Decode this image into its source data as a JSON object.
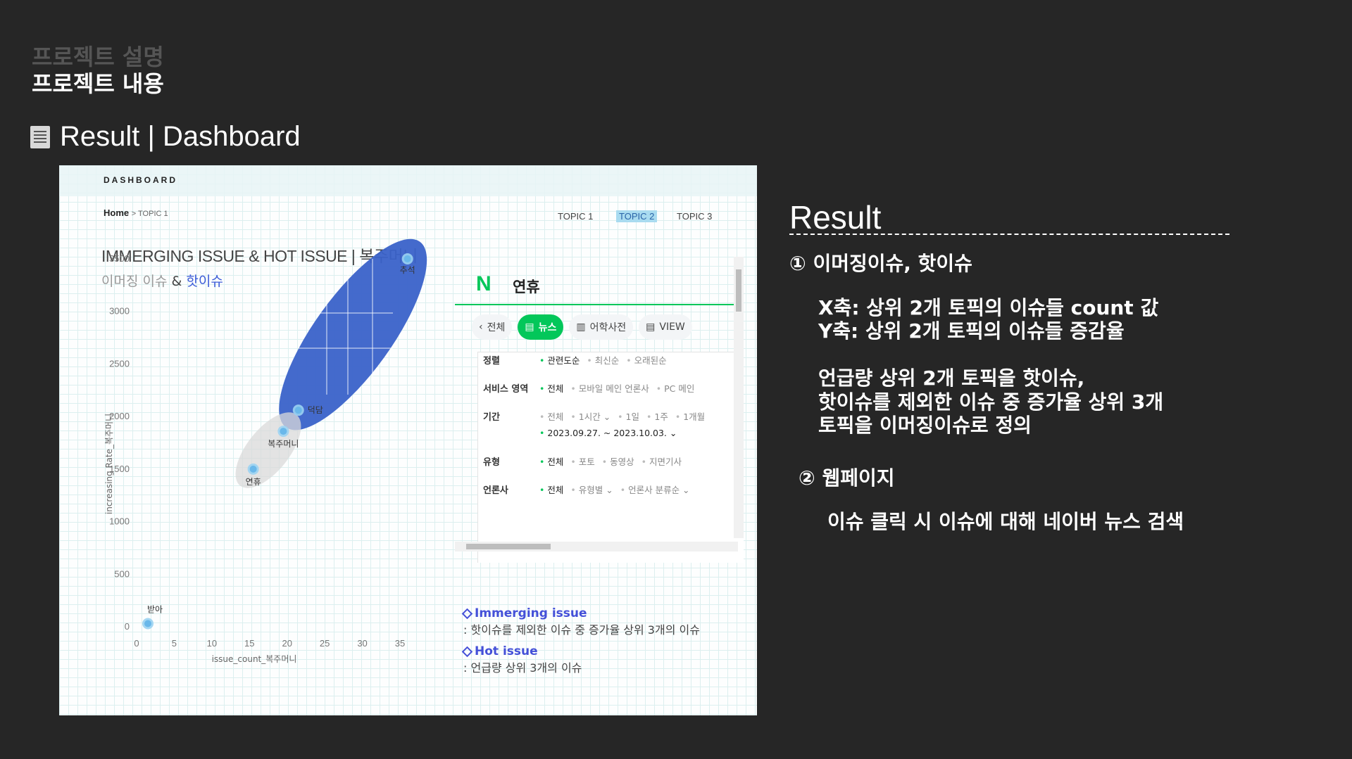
{
  "header": {
    "subtitle": "프로젝트 설명",
    "title": "프로젝트 내용",
    "section_title": "Result | Dashboard"
  },
  "dashboard": {
    "brand": "DASHBOARD",
    "breadcrumb_home": "Home",
    "breadcrumb_sub": "> TOPIC 1",
    "tabs": [
      {
        "label": "TOPIC 1",
        "active": false
      },
      {
        "label": "TOPIC 2",
        "active": true
      },
      {
        "label": "TOPIC 3",
        "active": false
      }
    ],
    "chart_title": "IMMERGING ISSUE & HOT ISSUE | 복주머니",
    "chart_subtitle_a": "이머징 이슈",
    "chart_subtitle_amp": "&",
    "chart_subtitle_b": "핫이슈"
  },
  "chart_data": {
    "type": "scatter",
    "title": "IMMERGING ISSUE & HOT ISSUE | 복주머니",
    "xlabel": "issue_count_복주머니",
    "ylabel": "increasing Rate_복주머니",
    "xlim": [
      0,
      35
    ],
    "ylim": [
      0,
      3500
    ],
    "x_ticks": [
      0,
      5,
      10,
      15,
      20,
      25,
      30,
      35
    ],
    "y_ticks": [
      0,
      500,
      1000,
      1500,
      2000,
      2500,
      3000,
      3500
    ],
    "grid": true,
    "points": [
      {
        "label": "받아",
        "x": 1.5,
        "y": 30
      },
      {
        "label": "연휴",
        "x": 15.5,
        "y": 1500
      },
      {
        "label": "복주머니",
        "x": 19.5,
        "y": 1860
      },
      {
        "label": "덕담",
        "x": 21.5,
        "y": 2060
      },
      {
        "label": "추석",
        "x": 36,
        "y": 3500
      }
    ],
    "groups": [
      {
        "label": "핫이슈",
        "members": [
          "덕담",
          "추석"
        ],
        "color": "#3a62c9"
      },
      {
        "label": "이머징 이슈",
        "members": [
          "연휴",
          "복주머니"
        ],
        "color": "#d9d9d9"
      }
    ]
  },
  "naver": {
    "logo": "N",
    "query": "연휴",
    "tabs": [
      {
        "label": "전체",
        "icon": "chevron-left-icon",
        "active": false
      },
      {
        "label": "뉴스",
        "icon": "news-icon",
        "active": true
      },
      {
        "label": "어학사전",
        "icon": "dictionary-icon",
        "active": false
      },
      {
        "label": "VIEW",
        "icon": "view-icon",
        "active": false
      }
    ],
    "filters": [
      {
        "key": "정렬",
        "options": [
          "관련도순",
          "최신순",
          "오래된순"
        ],
        "selected": 0
      },
      {
        "key": "서비스 영역",
        "options": [
          "전체",
          "모바일 메인 언론사",
          "PC 메인"
        ],
        "selected": 0
      },
      {
        "key": "기간",
        "options": [
          "전체",
          "1시간 ⌄",
          "1일",
          "1주",
          "1개월"
        ],
        "selected": -1
      },
      {
        "key": "",
        "options": [
          "2023.09.27. ~ 2023.10.03. ⌄"
        ],
        "selected": 0
      },
      {
        "key": "유형",
        "options": [
          "전체",
          "포토",
          "동영상",
          "지면기사"
        ],
        "selected": 0
      },
      {
        "key": "언론사",
        "options": [
          "전체",
          "유형별 ⌄",
          "언론사 분류순 ⌄"
        ],
        "selected": 0
      }
    ]
  },
  "legend": {
    "emerging_title": "Immerging issue",
    "emerging_desc": ": 핫이슈를 제외한 이슈 중 증가율 상위 3개의 이슈",
    "hot_title": "Hot issue",
    "hot_desc": ": 언급량 상위 3개의 이슈"
  },
  "result": {
    "title": "Result",
    "item1_heading": "① 이머징이슈, 핫이슈",
    "item1_lines": [
      "X축: 상위 2개 토픽의 이슈들 count  값",
      "Y축: 상위 2개 토픽의 이슈들 증감율",
      "",
      "언급량 상위 2개 토픽을 핫이슈,",
      "핫이슈를 제외한 이슈 중 증가율 상위 3개",
      "토픽을 이머징이슈로 정의"
    ],
    "item2_heading": "② 웹페이지",
    "item2_line": "이슈 클릭 시 이슈에 대해 네이버 뉴스 검색"
  }
}
